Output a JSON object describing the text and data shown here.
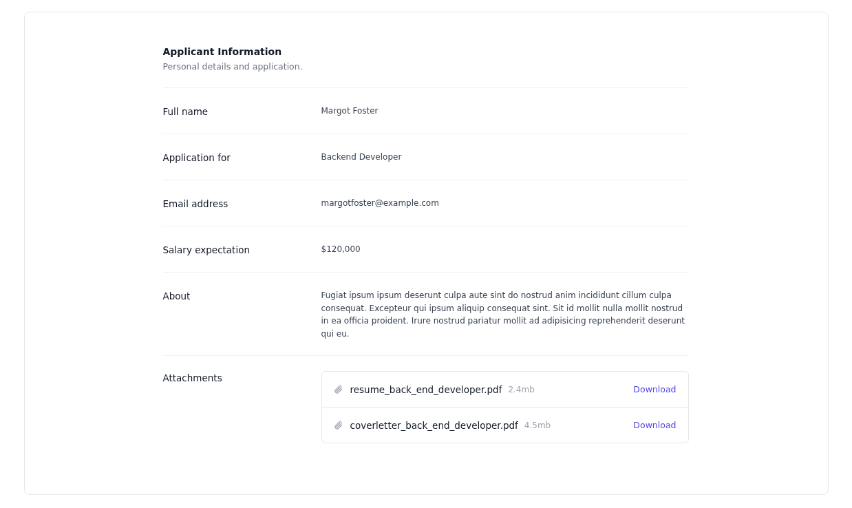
{
  "header": {
    "title": "Applicant Information",
    "subtitle": "Personal details and application."
  },
  "fields": [
    {
      "kind": "text",
      "label": "Full name",
      "value": "Margot Foster"
    },
    {
      "kind": "text",
      "label": "Application for",
      "value": "Backend Developer"
    },
    {
      "kind": "text",
      "label": "Email address",
      "value": "margotfoster@example.com"
    },
    {
      "kind": "text",
      "label": "Salary expectation",
      "value": "$120,000"
    },
    {
      "kind": "text",
      "label": "About",
      "value": "Fugiat ipsum ipsum deserunt culpa aute sint do nostrud anim incididunt cillum culpa consequat. Excepteur qui ipsum aliquip consequat sint. Sit id mollit nulla mollit nostrud in ea officia proident. Irure nostrud pariatur mollit ad adipisicing reprehenderit deserunt qui eu."
    },
    {
      "kind": "attachments",
      "label": "Attachments",
      "files": [
        {
          "name": "resume_back_end_developer.pdf",
          "size": "2.4mb",
          "action": "Download"
        },
        {
          "name": "coverletter_back_end_developer.pdf",
          "size": "4.5mb",
          "action": "Download"
        }
      ]
    }
  ]
}
